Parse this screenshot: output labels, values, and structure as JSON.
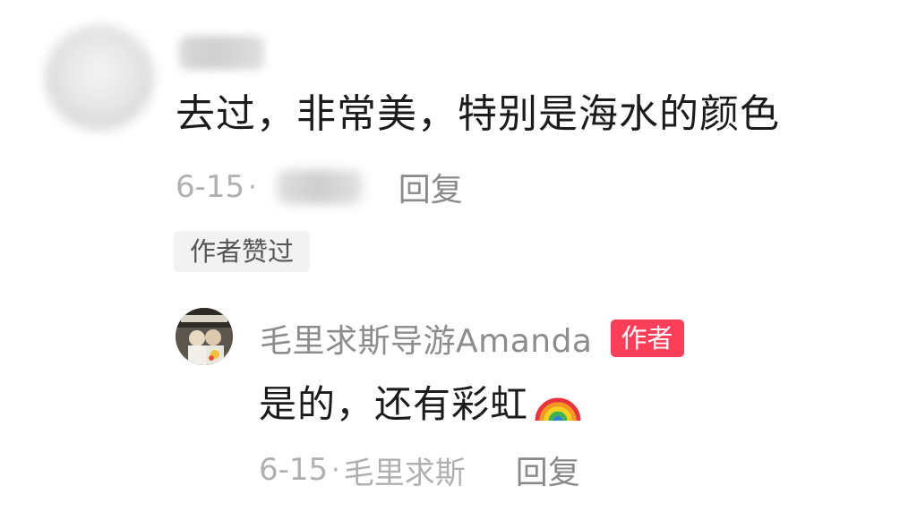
{
  "comment": {
    "text": "去过，非常美，特别是海水的颜色",
    "date": "6-15",
    "separator": "·",
    "reply_label": "回复",
    "liked_badge": "作者赞过"
  },
  "reply": {
    "username": "毛里求斯导游Amanda",
    "author_tag": "作者",
    "text": "是的，还有彩虹",
    "emoji": "rainbow-icon",
    "date": "6-15",
    "separator": "·",
    "location": "毛里求斯",
    "reply_label": "回复"
  },
  "colors": {
    "author_tag_bg": "#ff3f5a",
    "meta_gray": "#b0b0b0",
    "reply_gray": "#8a8a8a",
    "text_dark": "#1b1b1b"
  }
}
